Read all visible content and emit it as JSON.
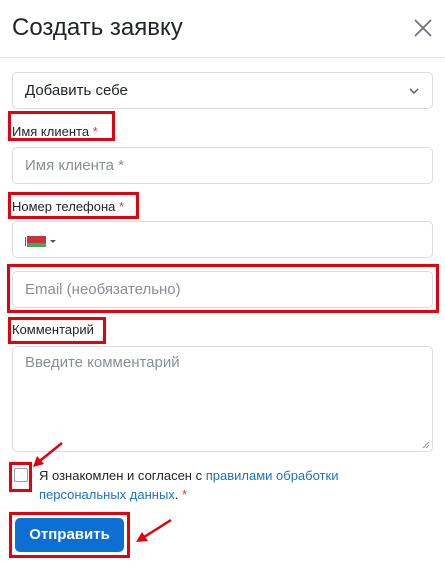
{
  "modal": {
    "title": "Создать заявку"
  },
  "form": {
    "assign_select": {
      "value": "Добавить себе"
    },
    "client_name": {
      "label": "Имя клиента",
      "required_mark": "*",
      "placeholder": "Имя клиента *"
    },
    "phone": {
      "label": "Номер телефона",
      "required_mark": "*",
      "country_flag": "belarus-flag-icon"
    },
    "email": {
      "placeholder": "Email (необязательно)"
    },
    "comment": {
      "label": "Комментарий",
      "placeholder": "Введите комментарий"
    },
    "consent": {
      "text_before": "Я ознакомлен и согласен с",
      "link_text": "правилами обработки персональных данных",
      "text_after": ".",
      "required_mark": "*"
    },
    "submit_label": "Отправить"
  },
  "colors": {
    "highlight": "#e3000f",
    "primary_button": "#0d6fd4",
    "link": "#1a73c8",
    "required": "#dc3545"
  }
}
